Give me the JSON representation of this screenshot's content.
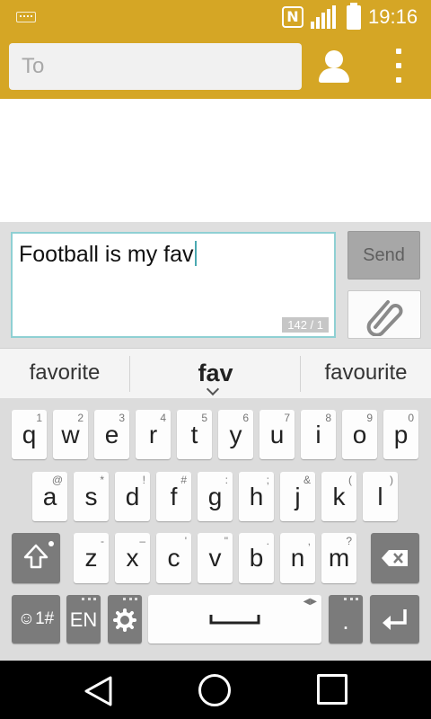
{
  "status_bar": {
    "nfc_label": "N",
    "time": "19:16"
  },
  "app_bar": {
    "to_placeholder": "To"
  },
  "compose": {
    "message_text": "Football is my fav",
    "counter": "142 / 1",
    "send_label": "Send"
  },
  "suggestions": {
    "left": "favorite",
    "middle": "fav",
    "right": "favourite"
  },
  "keyboard": {
    "row1": [
      {
        "key": "q",
        "sub": "1"
      },
      {
        "key": "w",
        "sub": "2"
      },
      {
        "key": "e",
        "sub": "3"
      },
      {
        "key": "r",
        "sub": "4"
      },
      {
        "key": "t",
        "sub": "5"
      },
      {
        "key": "y",
        "sub": "6"
      },
      {
        "key": "u",
        "sub": "7"
      },
      {
        "key": "i",
        "sub": "8"
      },
      {
        "key": "o",
        "sub": "9"
      },
      {
        "key": "p",
        "sub": "0"
      }
    ],
    "row2": [
      {
        "key": "a",
        "sub": "@"
      },
      {
        "key": "s",
        "sub": "*"
      },
      {
        "key": "d",
        "sub": "!"
      },
      {
        "key": "f",
        "sub": "#"
      },
      {
        "key": "g",
        "sub": ":"
      },
      {
        "key": "h",
        "sub": ";"
      },
      {
        "key": "j",
        "sub": "&"
      },
      {
        "key": "k",
        "sub": "("
      },
      {
        "key": "l",
        "sub": ")"
      }
    ],
    "row3": [
      {
        "key": "z",
        "sub": "-"
      },
      {
        "key": "x",
        "sub": "–"
      },
      {
        "key": "c",
        "sub": "'"
      },
      {
        "key": "v",
        "sub": "\""
      },
      {
        "key": "b",
        "sub": "."
      },
      {
        "key": "n",
        "sub": ","
      },
      {
        "key": "m",
        "sub": "?"
      }
    ],
    "emoji_label": "☺1#",
    "lang_label": "EN",
    "period_label": "."
  },
  "colors": {
    "accent": "#d5a625",
    "focus_border": "#8fd0d3"
  }
}
